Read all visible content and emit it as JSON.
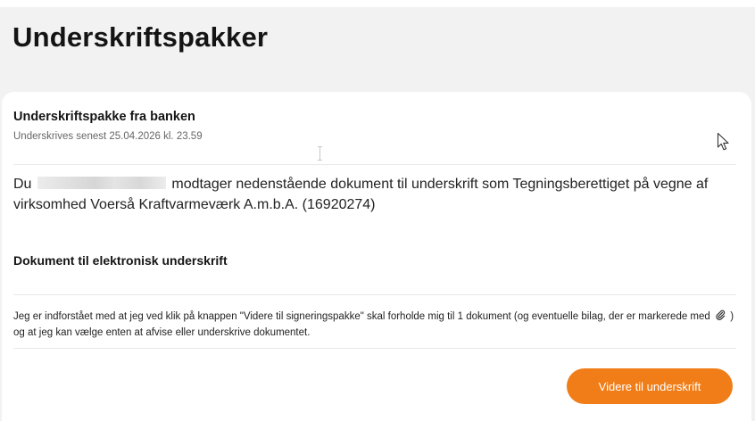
{
  "page": {
    "title": "Underskriftspakker"
  },
  "package": {
    "title": "Underskriftspakke fra banken",
    "deadline": "Underskrives senest 25.04.2026 kl. 23.59"
  },
  "intro": {
    "prefix": "Du",
    "suffix": "modtager nedenstående dokument til underskrift som Tegningsberettiget på vegne af virksomhed Voerså Kraftvarmeværk A.m.b.A. (16920274)"
  },
  "documents": {
    "section_title": "Dokument til elektronisk underskrift"
  },
  "consent": {
    "text_before_icon": "Jeg er indforstået med at jeg ved klik på knappen \"Videre til signeringspakke\" skal forholde mig til 1 dokument (og eventuelle bilag, der er markerede med",
    "text_after_icon": ") og at jeg kan vælge enten at afvise eller underskrive dokumentet."
  },
  "actions": {
    "continue_label": "Videre til underskrift"
  },
  "colors": {
    "accent": "#f07d18",
    "background": "#f2f2f2",
    "card": "#ffffff"
  },
  "icons": {
    "cursor": "mouse-pointer-icon",
    "attachment": "paperclip-icon"
  }
}
